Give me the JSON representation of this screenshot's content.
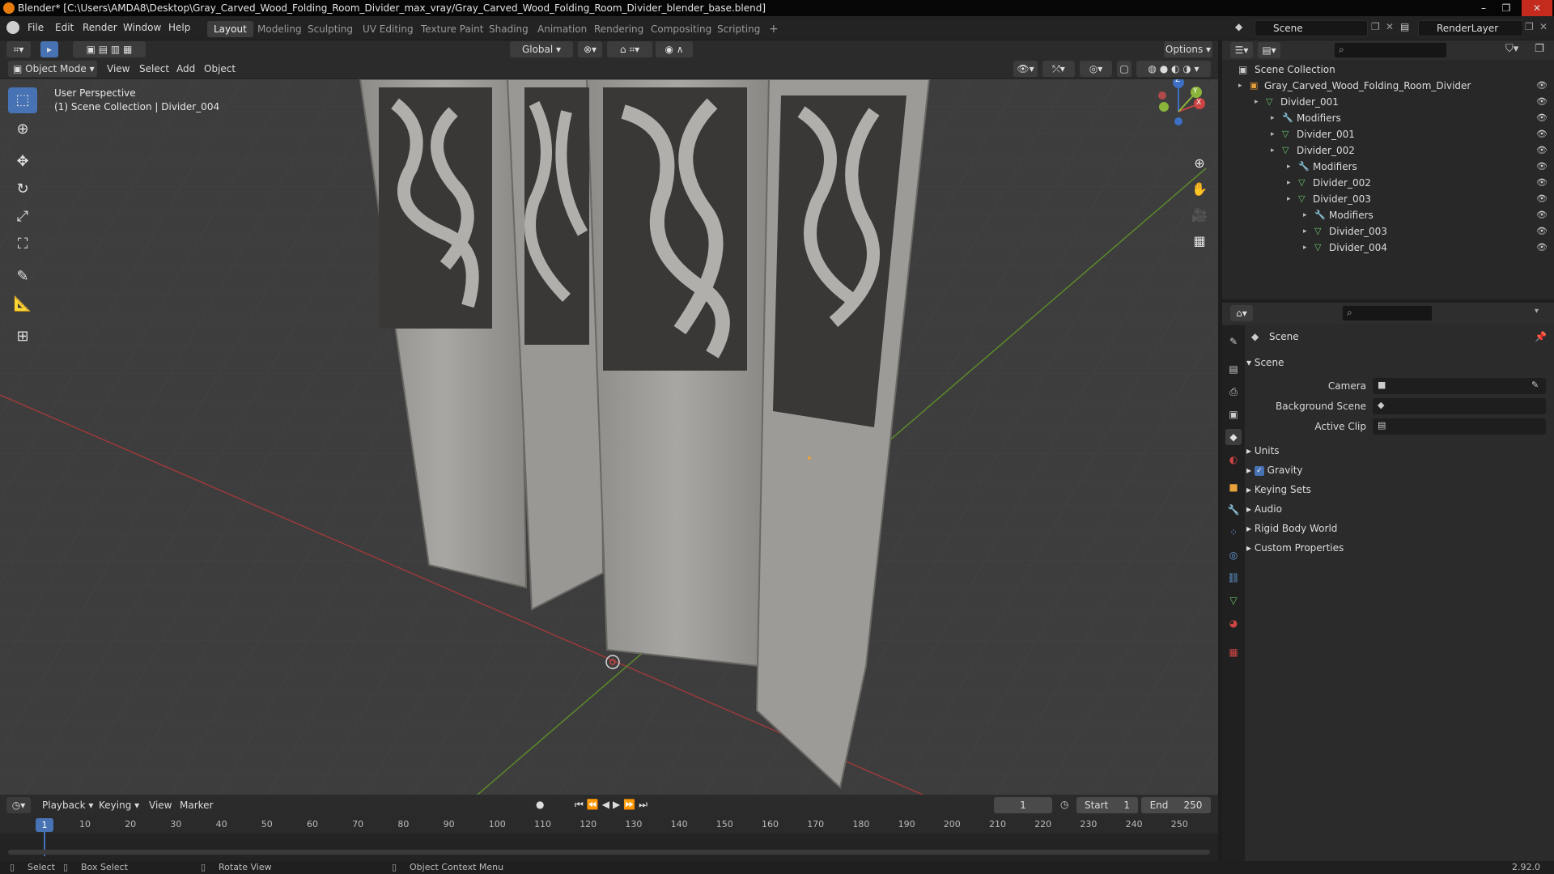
{
  "window": {
    "title": "Blender* [C:\\Users\\AMDA8\\Desktop\\Gray_Carved_Wood_Folding_Room_Divider_max_vray/Gray_Carved_Wood_Folding_Room_Divider_blender_base.blend]",
    "btn_min": "–",
    "btn_max": "❐",
    "btn_close": "✕"
  },
  "menu": [
    "File",
    "Edit",
    "Render",
    "Window",
    "Help"
  ],
  "workspaces": [
    "Layout",
    "Modeling",
    "Sculpting",
    "UV Editing",
    "Texture Paint",
    "Shading",
    "Animation",
    "Rendering",
    "Compositing",
    "Scripting"
  ],
  "add_workspace": "+",
  "scene_field": "Scene",
  "renderlayer_field": "RenderLayer",
  "viewport_header": {
    "orientation": "Global",
    "options": "Options",
    "mode": "Object Mode",
    "view": "View",
    "select": "Select",
    "add": "Add",
    "object": "Object"
  },
  "viewport": {
    "perspective": "User Perspective",
    "collection_info": "(1) Scene Collection | Divider_004",
    "gizmo_x": "X",
    "gizmo_y": "Y",
    "gizmo_z": "Z"
  },
  "tools": [
    "⬚",
    "⊕",
    "✥",
    "↻",
    "⤢",
    "⛶",
    "✎",
    "📐",
    "⊞"
  ],
  "nav_icons": [
    "⊕",
    "✋",
    "🎥",
    "▦"
  ],
  "outliner": {
    "root": "Scene Collection",
    "rows": [
      {
        "label": "Gray_Carved_Wood_Folding_Room_Divider",
        "indent": 1
      },
      {
        "label": "Divider_001",
        "indent": 2
      },
      {
        "label": "Modifiers",
        "indent": 3
      },
      {
        "label": "Divider_001",
        "indent": 3
      },
      {
        "label": "Divider_002",
        "indent": 3
      },
      {
        "label": "Modifiers",
        "indent": 4
      },
      {
        "label": "Divider_002",
        "indent": 4
      },
      {
        "label": "Divider_003",
        "indent": 4
      },
      {
        "label": "Modifiers",
        "indent": 5
      },
      {
        "label": "Divider_003",
        "indent": 5
      },
      {
        "label": "Divider_004",
        "indent": 5
      }
    ]
  },
  "properties": {
    "context": "Scene",
    "section": "Scene",
    "camera_label": "Camera",
    "bg_scene_label": "Background Scene",
    "active_clip_label": "Active Clip",
    "sections": [
      "Units",
      "Gravity",
      "Keying Sets",
      "Audio",
      "Rigid Body World",
      "Custom Properties"
    ],
    "gravity_checked": true
  },
  "timeline": {
    "playback": "Playback",
    "keying": "Keying",
    "view": "View",
    "marker": "Marker",
    "current_frame": "1",
    "start_label": "Start",
    "start": "1",
    "end_label": "End",
    "end": "250",
    "ticks": [
      "10",
      "20",
      "30",
      "40",
      "50",
      "60",
      "70",
      "80",
      "90",
      "100",
      "110",
      "120",
      "130",
      "140",
      "150",
      "160",
      "170",
      "180",
      "190",
      "200",
      "210",
      "220",
      "230",
      "240",
      "250"
    ],
    "cursor_frame": "1"
  },
  "status": {
    "select": "Select",
    "box_select": "Box Select",
    "rotate_view": "Rotate View",
    "context_menu": "Object Context Menu",
    "version": "2.92.0"
  },
  "colors": {
    "accent": "#4772b3",
    "axis_x": "#a83a3a",
    "axis_y": "#5c8a2a"
  }
}
